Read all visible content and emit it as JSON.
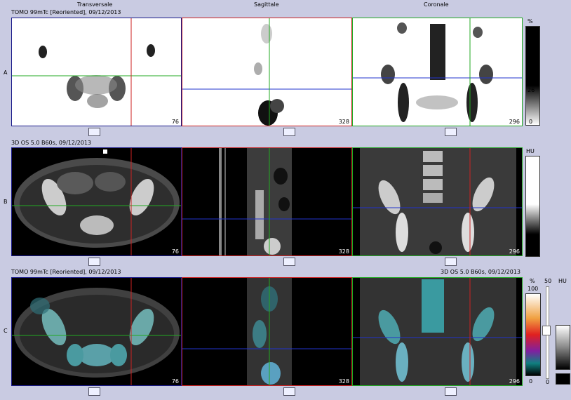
{
  "views": {
    "transversal": "Transversale",
    "sagittal": "Sagittale",
    "coronal": "Coronale"
  },
  "rows": {
    "a": {
      "label": "A",
      "title": "TOMO 99mTc [Reoriented], 09/12/2013"
    },
    "b": {
      "label": "B",
      "title": "3D  OS  5.0  B60s, 09/12/2013"
    },
    "c": {
      "label": "C",
      "title": "TOMO 99mTc [Reoriented], 09/12/2013",
      "title_right": "3D  OS  5.0  B60s, 09/12/2013"
    }
  },
  "slices": {
    "transversal": "76",
    "sagittal": "328",
    "coronal": "296"
  },
  "colorbars": {
    "a": {
      "unit": "%",
      "marker": "26",
      "bottom": "0"
    },
    "b": {
      "unit": "HU"
    },
    "c": {
      "unit_left": "%",
      "top_left": "100",
      "bottom_left": "0",
      "value_mid": "50",
      "unit_right": "HU",
      "bottom_mid": "0"
    }
  },
  "colors": {
    "transversal_frame": "#1a1a8a",
    "sagittal_frame": "#cc2222",
    "coronal_frame": "#22aa22",
    "crosshair_h": "#2233cc",
    "crosshair_v": "#cc2222"
  },
  "icons": {
    "slice_scrollbar": "scrollbar-thumb"
  }
}
